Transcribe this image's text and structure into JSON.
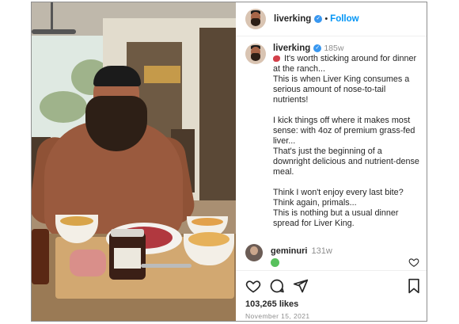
{
  "header": {
    "username": "liverking",
    "separator": "•",
    "follow_label": "Follow"
  },
  "post": {
    "author": "liverking",
    "age": "185w",
    "caption": {
      "line1": "It's worth sticking around for dinner at the ranch...",
      "line2": "This is when Liver King consumes a serious amount of nose-to-tail nutrients!",
      "line3": "I kick things off where it makes most sense: with 4oz of premium grass-fed liver...",
      "line4": "That's just the beginning of a downright delicious and nutrient-dense meal.",
      "line5": "Think I won't enjoy every last bite?",
      "line6": "Think again, primals...",
      "line7": "This is nothing but a usual dinner spread for Liver King."
    }
  },
  "comment": {
    "username": "geminuri",
    "age": "131w"
  },
  "engagement": {
    "likes": "103,265 likes",
    "date": "November 15, 2021"
  },
  "colors": {
    "follow_blue": "#0095f6",
    "verified_blue": "#3897f0",
    "text": "#262626",
    "muted": "#8e8e8e"
  },
  "icons": [
    "verified-badge-icon",
    "meat-emoji-icon",
    "heart-icon",
    "comment-icon",
    "share-icon",
    "bookmark-icon"
  ]
}
